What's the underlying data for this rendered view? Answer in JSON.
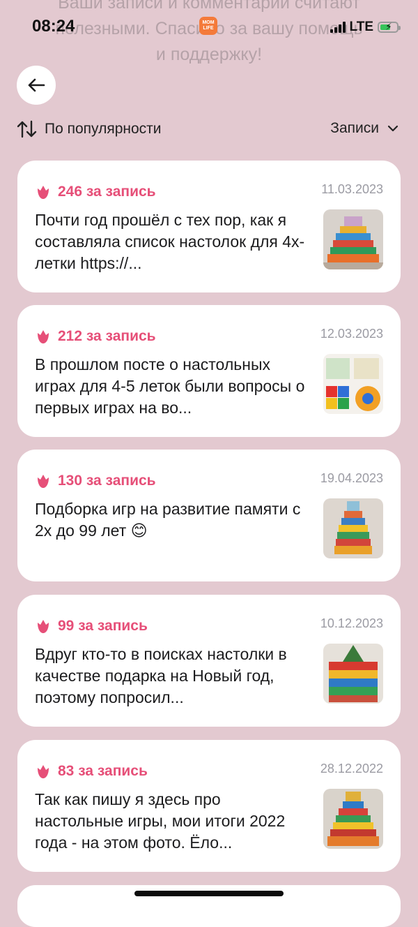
{
  "header_message": {
    "line1": "Ваши записи и комментарии считают",
    "line2": "полезными. Спасибо за вашу помощь",
    "line3": "и поддержку!"
  },
  "status_bar": {
    "time": "08:24",
    "network": "LTE",
    "app_logo_line1": "MOM",
    "app_logo_line2": "LIFE"
  },
  "sort": {
    "label": "По популярности",
    "filter_label": "Записи"
  },
  "posts": [
    {
      "reward": "246 за запись",
      "date": "11.03.2023",
      "text": "Почти год прошёл с тех пор, как я составляла список настолок для 4х-летки https://..."
    },
    {
      "reward": "212 за запись",
      "date": "12.03.2023",
      "text": "В прошлом посте о настольных играх для 4-5 леток были вопросы о первых играх на во..."
    },
    {
      "reward": "130 за запись",
      "date": "19.04.2023",
      "text": "Подборка игр на развитие памяти с 2х до 99 лет 😊"
    },
    {
      "reward": "99 за запись",
      "date": "10.12.2023",
      "text": "Вдруг кто-то в поисках настолки в качестве подарка на Новый год, поэтому попросил..."
    },
    {
      "reward": "83 за запись",
      "date": "28.12.2022",
      "text": "Так как пишу я здесь про настольные игры, мои итоги 2022 года - на этом фото. Ёло..."
    }
  ],
  "colors": {
    "accent": "#e64f78",
    "background": "#e3c9d0",
    "card": "#ffffff"
  }
}
